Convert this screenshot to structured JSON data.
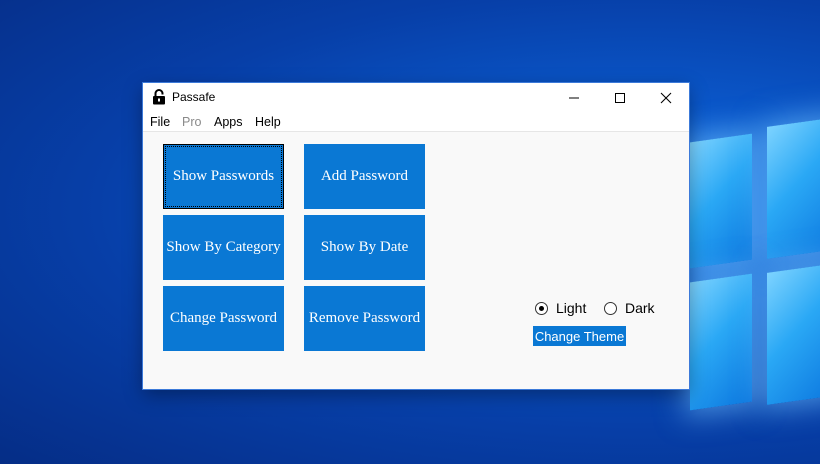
{
  "window": {
    "title": "Passafe",
    "app_icon": "lock-icon",
    "controls": [
      "minimize-icon",
      "maximize-icon",
      "close-icon"
    ]
  },
  "menu": [
    "File",
    "Pro",
    "Apps",
    "Help"
  ],
  "menu_disabled": [
    "Pro"
  ],
  "buttons": {
    "show_passwords": "Show Passwords",
    "add_password": "Add Password",
    "show_by_category": "Show By Category",
    "show_by_date": "Show By Date",
    "change_password": "Change Password",
    "remove_password": "Remove Password"
  },
  "theme": {
    "options": [
      "Light",
      "Dark"
    ],
    "selected": "Light",
    "change_button": "Change Theme"
  },
  "colors": {
    "accent": "#0a78d4",
    "window_bg": "#f9f9f9",
    "desktop": "#0a56c8"
  }
}
